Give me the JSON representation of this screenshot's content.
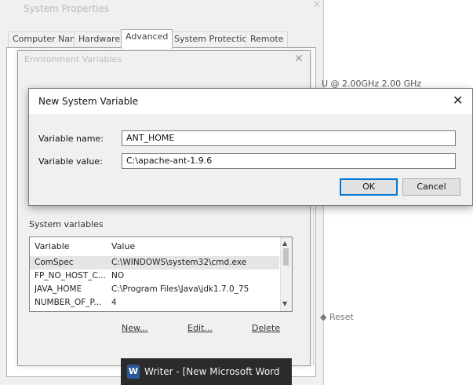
{
  "system_properties": {
    "title": "System Properties",
    "tabs": [
      {
        "label": "Computer Name",
        "active": false
      },
      {
        "label": "Hardware",
        "active": false
      },
      {
        "label": "Advanced",
        "active": true
      },
      {
        "label": "System Protection",
        "active": false
      },
      {
        "label": "Remote",
        "active": false
      }
    ],
    "cpu_text": "U @ 2.00GHz   2.00 GHz",
    "remote_text": "Reset"
  },
  "environment_variables": {
    "title": "Environment Variables",
    "system_vars_label": "System variables",
    "columns": [
      "Variable",
      "Value"
    ],
    "rows": [
      {
        "variable": "ComSpec",
        "value": "C:\\WINDOWS\\system32\\cmd.exe",
        "selected": true
      },
      {
        "variable": "FP_NO_HOST_C...",
        "value": "NO",
        "selected": false
      },
      {
        "variable": "JAVA_HOME",
        "value": "C:\\Program Files\\Java\\jdk1.7.0_75",
        "selected": false
      },
      {
        "variable": "NUMBER_OF_P...",
        "value": "4",
        "selected": false
      }
    ],
    "buttons": {
      "new": "New...",
      "edit": "Edit...",
      "delete": "Delete"
    }
  },
  "new_system_variable": {
    "title": "New System Variable",
    "name_label": "Variable name:",
    "value_label": "Variable value:",
    "name_value": "ANT_HOME",
    "value_value": "C:\\apache-ant-1.9.6",
    "ok_label": "OK",
    "cancel_label": "Cancel"
  },
  "taskbar": {
    "label": "Writer - [New Microsoft Word",
    "icon": "word-icon",
    "icon_letter": "W"
  },
  "colors": {
    "accent": "#0078d7",
    "taskbar_bg": "#2b2b2b",
    "word_blue": "#2b579a"
  }
}
